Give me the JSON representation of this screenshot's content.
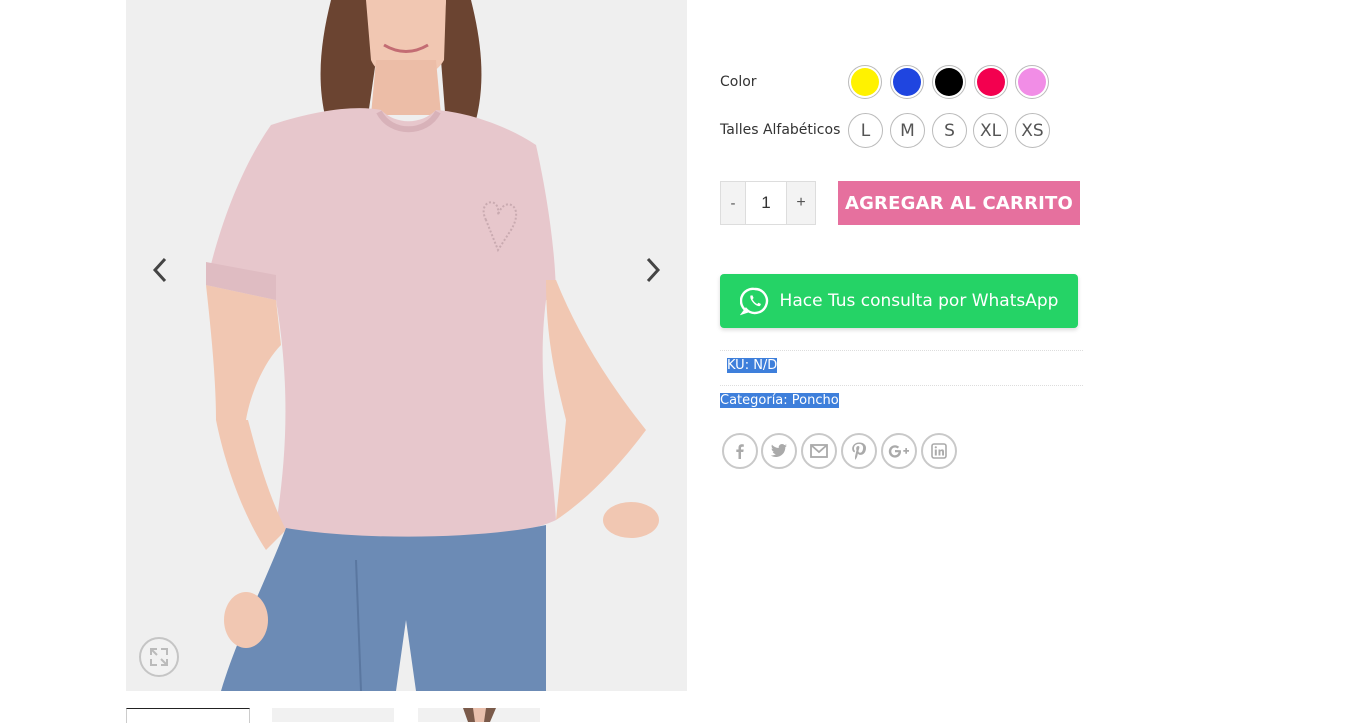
{
  "gallery": {
    "image_alt": "Remera rosa",
    "prev_icon": "chevron-left-icon",
    "next_icon": "chevron-right-icon",
    "zoom_icon": "expand-icon",
    "thumbnails": 3
  },
  "attributes": {
    "color_label": "Color",
    "colors": [
      {
        "name": "Amarillo",
        "hex": "#fff200"
      },
      {
        "name": "Azul",
        "hex": "#1f45e0"
      },
      {
        "name": "Negro",
        "hex": "#000000"
      },
      {
        "name": "Fucsia",
        "hex": "#f3004f"
      },
      {
        "name": "Rosa",
        "hex": "#f18de6"
      }
    ],
    "size_label": "Talles Alfabéticos",
    "sizes": [
      "L",
      "M",
      "S",
      "XL",
      "XS"
    ]
  },
  "quantity": {
    "minus": "-",
    "value": "1",
    "plus": "+"
  },
  "cart_button": "AGREGAR AL CARRITO",
  "whatsapp_button": "Hace Tus consulta por WhatsApp",
  "meta": {
    "sku": "KU: N/D",
    "category_prefix": "Categoría: ",
    "category": "Poncho"
  },
  "share": [
    "facebook-icon",
    "twitter-icon",
    "email-icon",
    "pinterest-icon",
    "google-plus-icon",
    "linkedin-icon"
  ],
  "colors": {
    "cart": "#e6709e",
    "whatsapp": "#25d366",
    "selection": "#3e7fdb"
  }
}
